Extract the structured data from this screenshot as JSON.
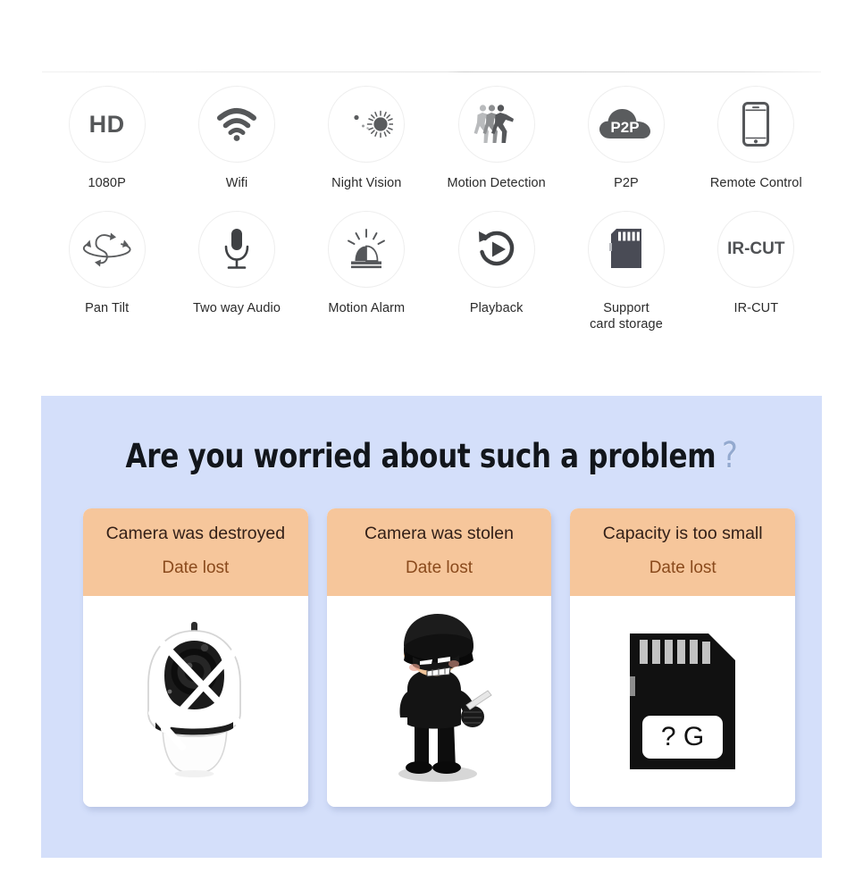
{
  "features": {
    "row1": [
      {
        "label": "1080P",
        "icon": "hd-icon",
        "icon_text": "HD"
      },
      {
        "label": "Wifi",
        "icon": "wifi-icon",
        "icon_text": ""
      },
      {
        "label": "Night Vision",
        "icon": "moon-sun-icon",
        "icon_text": ""
      },
      {
        "label": "Motion Detection",
        "icon": "walking-people-icon",
        "icon_text": ""
      },
      {
        "label": "P2P",
        "icon": "cloud-p2p-icon",
        "icon_text": "P2P"
      },
      {
        "label": "Remote Control",
        "icon": "smartphone-icon",
        "icon_text": ""
      }
    ],
    "row2": [
      {
        "label": "Pan Tilt",
        "icon": "pan-tilt-rotation-icon",
        "icon_text": ""
      },
      {
        "label": "Two way Audio",
        "icon": "microphone-icon",
        "icon_text": ""
      },
      {
        "label": "Motion Alarm",
        "icon": "siren-alarm-icon",
        "icon_text": ""
      },
      {
        "label": "Playback",
        "icon": "rewind-play-icon",
        "icon_text": ""
      },
      {
        "label": "Support\ncard storage",
        "icon": "sd-card-icon",
        "icon_text": ""
      },
      {
        "label": "IR-CUT",
        "icon": "ir-cut-text-icon",
        "icon_text": "IR-CUT"
      }
    ]
  },
  "problem_section": {
    "title": "Are you worried about such a problem",
    "title_question_mark": "?",
    "cards": [
      {
        "title": "Camera was destroyed",
        "subtitle": "Date lost",
        "image": "broken-camera-illustration",
        "image_label": ""
      },
      {
        "title": "Camera was stolen",
        "subtitle": "Date lost",
        "image": "thief-illustration",
        "image_label": ""
      },
      {
        "title": "Capacity is too small",
        "subtitle": "Date lost",
        "image": "sd-card-illustration",
        "image_label": "? G"
      }
    ]
  },
  "colors": {
    "panel_background": "#d4dffa",
    "card_header": "#f6c69b",
    "card_subtitle_text": "#8a4a1c",
    "title_text": "#12161c",
    "question_mark": "#93a9cf",
    "icon_gray": "#555759"
  }
}
